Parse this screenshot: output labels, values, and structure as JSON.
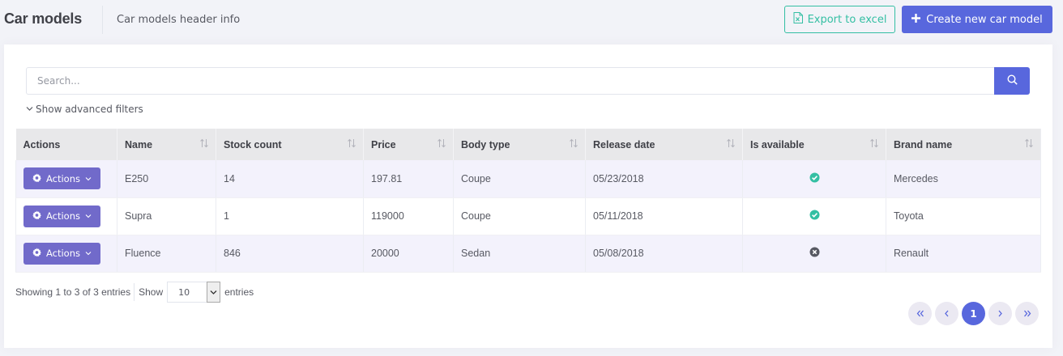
{
  "header": {
    "title": "Car models",
    "info": "Car models header info",
    "export_label": "Export to excel",
    "create_label": "Create new car model"
  },
  "search": {
    "placeholder": "Search...",
    "advanced_filters_label": "Show advanced filters"
  },
  "table": {
    "columns": [
      "Actions",
      "Name",
      "Stock count",
      "Price",
      "Body type",
      "Release date",
      "Is available",
      "Brand name"
    ],
    "action_button_label": "Actions",
    "rows": [
      {
        "name": "E250",
        "stock": "14",
        "price": "197.81",
        "body": "Coupe",
        "release": "05/23/2018",
        "available": true,
        "brand": "Mercedes"
      },
      {
        "name": "Supra",
        "stock": "1",
        "price": "119000",
        "body": "Coupe",
        "release": "05/11/2018",
        "available": true,
        "brand": "Toyota"
      },
      {
        "name": "Fluence",
        "stock": "846",
        "price": "20000",
        "body": "Sedan",
        "release": "05/08/2018",
        "available": false,
        "brand": "Renault"
      }
    ]
  },
  "footer": {
    "showing_text": "Showing 1 to 3 of 3 entries",
    "show_label": "Show",
    "page_size": "10",
    "entries_label": "entries",
    "current_page": "1"
  },
  "colors": {
    "primary": "#5867dd",
    "success": "#34bfa3",
    "action_button": "#716aca",
    "unavailable": "#575962"
  }
}
